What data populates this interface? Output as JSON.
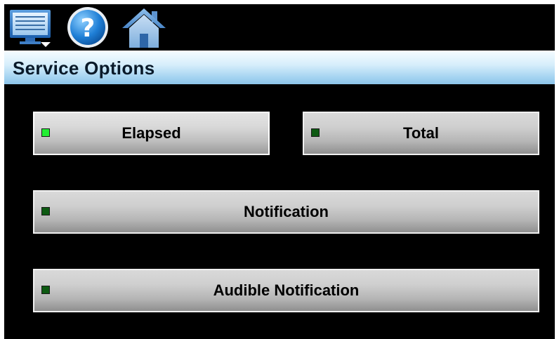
{
  "header": {
    "title": "Service Options"
  },
  "toolbar": {
    "icons": [
      "menu-monitor-icon",
      "help-icon",
      "home-icon"
    ]
  },
  "options": [
    {
      "label": "Elapsed",
      "led_on": true
    },
    {
      "label": "Total",
      "led_on": false
    },
    {
      "label": "Notification",
      "led_on": false
    },
    {
      "label": "Audible Notification",
      "led_on": false
    }
  ],
  "colors": {
    "led_on": "#22ee33",
    "led_off": "#0d5a12",
    "background": "#000000"
  }
}
